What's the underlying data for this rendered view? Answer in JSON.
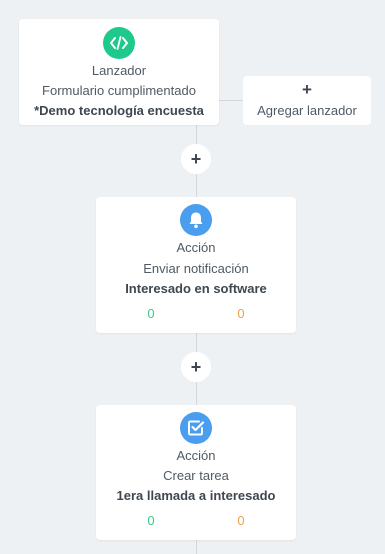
{
  "trigger": {
    "icon": "code-icon",
    "color": "#1ec98b",
    "type_label": "Lanzador",
    "subtitle": "Formulario cumplimentado",
    "name": "*Demo tecnología encuesta"
  },
  "add_trigger": {
    "plus": "+",
    "label": "Agregar lanzador"
  },
  "add_step_symbol": "+",
  "actions": [
    {
      "icon": "bell-icon",
      "color": "#4a9ef0",
      "type_label": "Acción",
      "subtitle": "Enviar notificación",
      "name": "Interesado en software",
      "count_green": "0",
      "count_orange": "0"
    },
    {
      "icon": "task-check-icon",
      "color": "#4a9ef0",
      "type_label": "Acción",
      "subtitle": "Crear tarea",
      "name": "1era llamada a interesado",
      "count_green": "0",
      "count_orange": "0"
    }
  ]
}
